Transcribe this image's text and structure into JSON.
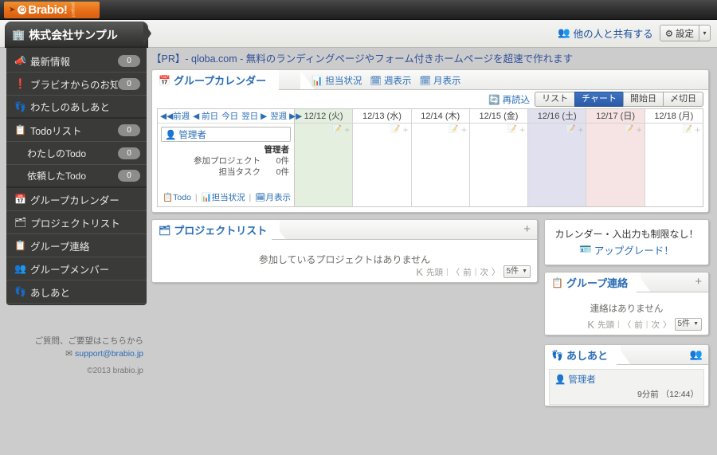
{
  "brand": {
    "logo_text": "Brabio",
    "logo_bang": "!",
    "logo_sub": "project"
  },
  "header": {
    "company_name": "株式会社サンプル",
    "share_label": "他の人と共有する",
    "settings_label": "設定",
    "settings_caret": "▾"
  },
  "pr": {
    "text": "【PR】- qloba.com - 無料のランディングページやフォーム付きホームページを超速で作れます"
  },
  "sidebar": {
    "items": [
      {
        "label": "最新情報",
        "icon": "megaphone-icon",
        "glyph": "📣",
        "badge": "0",
        "sub": false
      },
      {
        "label": "ブラビオからのお知らせ",
        "icon": "alert-icon",
        "glyph": "❗",
        "badge": "0",
        "sub": false
      },
      {
        "label": "わたしのあしあと",
        "icon": "footprint-icon",
        "glyph": "👣",
        "badge": "",
        "sub": false
      },
      {
        "label": "Todoリスト",
        "icon": "todo-icon",
        "glyph": "📋",
        "badge": "0",
        "sub": false
      },
      {
        "label": "わたしのTodo",
        "icon": "",
        "glyph": "",
        "badge": "0",
        "sub": true
      },
      {
        "label": "依頼したTodo",
        "icon": "",
        "glyph": "",
        "badge": "0",
        "sub": true
      },
      {
        "label": "グループカレンダー",
        "icon": "calendar-icon",
        "glyph": "📅",
        "badge": "",
        "sub": false
      },
      {
        "label": "プロジェクトリスト",
        "icon": "projects-icon",
        "glyph": "🗂",
        "badge": "",
        "sub": false
      },
      {
        "label": "グループ連絡",
        "icon": "board-icon",
        "glyph": "📋",
        "badge": "",
        "sub": false
      },
      {
        "label": "グループメンバー",
        "icon": "members-icon",
        "glyph": "👥",
        "badge": "",
        "sub": false
      },
      {
        "label": "あしあと",
        "icon": "footprint-icon",
        "glyph": "👣",
        "badge": "",
        "sub": false
      }
    ],
    "footer": {
      "contact_text": "ご質問、ご要望はこちらから",
      "email": "support@brabio.jp",
      "copyright": "©2013 brabio.jp"
    }
  },
  "calendar": {
    "title": "グループカレンダー",
    "tabs": [
      {
        "label": "担当状況",
        "icon": "bar-chart-icon",
        "glyph": "📊"
      },
      {
        "label": "週表示",
        "icon": "week-view-icon",
        "glyph": "🗓"
      },
      {
        "label": "月表示",
        "icon": "month-view-icon",
        "glyph": "🗓"
      }
    ],
    "reload_label": "再読込",
    "view_buttons": [
      {
        "label": "リスト",
        "active": false
      },
      {
        "label": "チャート",
        "active": true
      },
      {
        "label": "開始日",
        "active": false
      },
      {
        "label": "〆切日",
        "active": false
      }
    ],
    "nav": [
      {
        "label": "◀◀前週"
      },
      {
        "label": "◀ 前日"
      },
      {
        "label": "今日"
      },
      {
        "label": "翌日 ▶"
      },
      {
        "label": "翌週 ▶▶"
      }
    ],
    "user_chip": "管理者",
    "stats": {
      "owner": "管理者",
      "rows": [
        {
          "label": "参加プロジェクト",
          "value": "0件"
        },
        {
          "label": "担当タスク",
          "value": "0件"
        }
      ],
      "links": [
        {
          "label": "Todo",
          "icon": "todo-icon",
          "glyph": "📋"
        },
        {
          "label": "担当状況",
          "icon": "bar-chart-icon",
          "glyph": "📊"
        },
        {
          "label": "月表示",
          "icon": "month-view-icon",
          "glyph": "🗓"
        }
      ]
    },
    "days": [
      {
        "label": "12/12 (火)",
        "tint": "#e4efe0"
      },
      {
        "label": "12/13 (水)",
        "tint": "#ffffff"
      },
      {
        "label": "12/14 (木)",
        "tint": "#ffffff"
      },
      {
        "label": "12/15 (金)",
        "tint": "#ffffff"
      },
      {
        "label": "12/16 (土)",
        "tint": "#e0e0ee"
      },
      {
        "label": "12/17 (日)",
        "tint": "#f6e3e3"
      },
      {
        "label": "12/18 (月)",
        "tint": "#ffffff"
      }
    ],
    "cell_plus": "+",
    "cell_todo_glyph": "📝"
  },
  "projects": {
    "title": "プロジェクトリスト",
    "add_label": "+",
    "empty_message": "参加しているプロジェクトはありません",
    "pager": {
      "first": "先頭",
      "prev": "前",
      "next": "次",
      "page_size": "5件",
      "caret": "▼"
    }
  },
  "upgrade": {
    "line1": "カレンダー・入出力も制限なし！",
    "line2": "アップグレード！"
  },
  "contact": {
    "title": "グループ連絡",
    "add_label": "+",
    "empty_message": "連絡はありません",
    "pager": {
      "first": "先頭",
      "prev": "前",
      "next": "次",
      "page_size": "5件",
      "caret": "▼"
    }
  },
  "footprint": {
    "title": "あしあと",
    "entries": [
      {
        "user": "管理者",
        "when": "9分前 （12:44）"
      }
    ]
  },
  "colors": {
    "accent_blue": "#2a6db5",
    "brand_orange": "#e8701a",
    "sidebar_bg": "#3a3a38",
    "active_tab": "#2a5ba8"
  }
}
